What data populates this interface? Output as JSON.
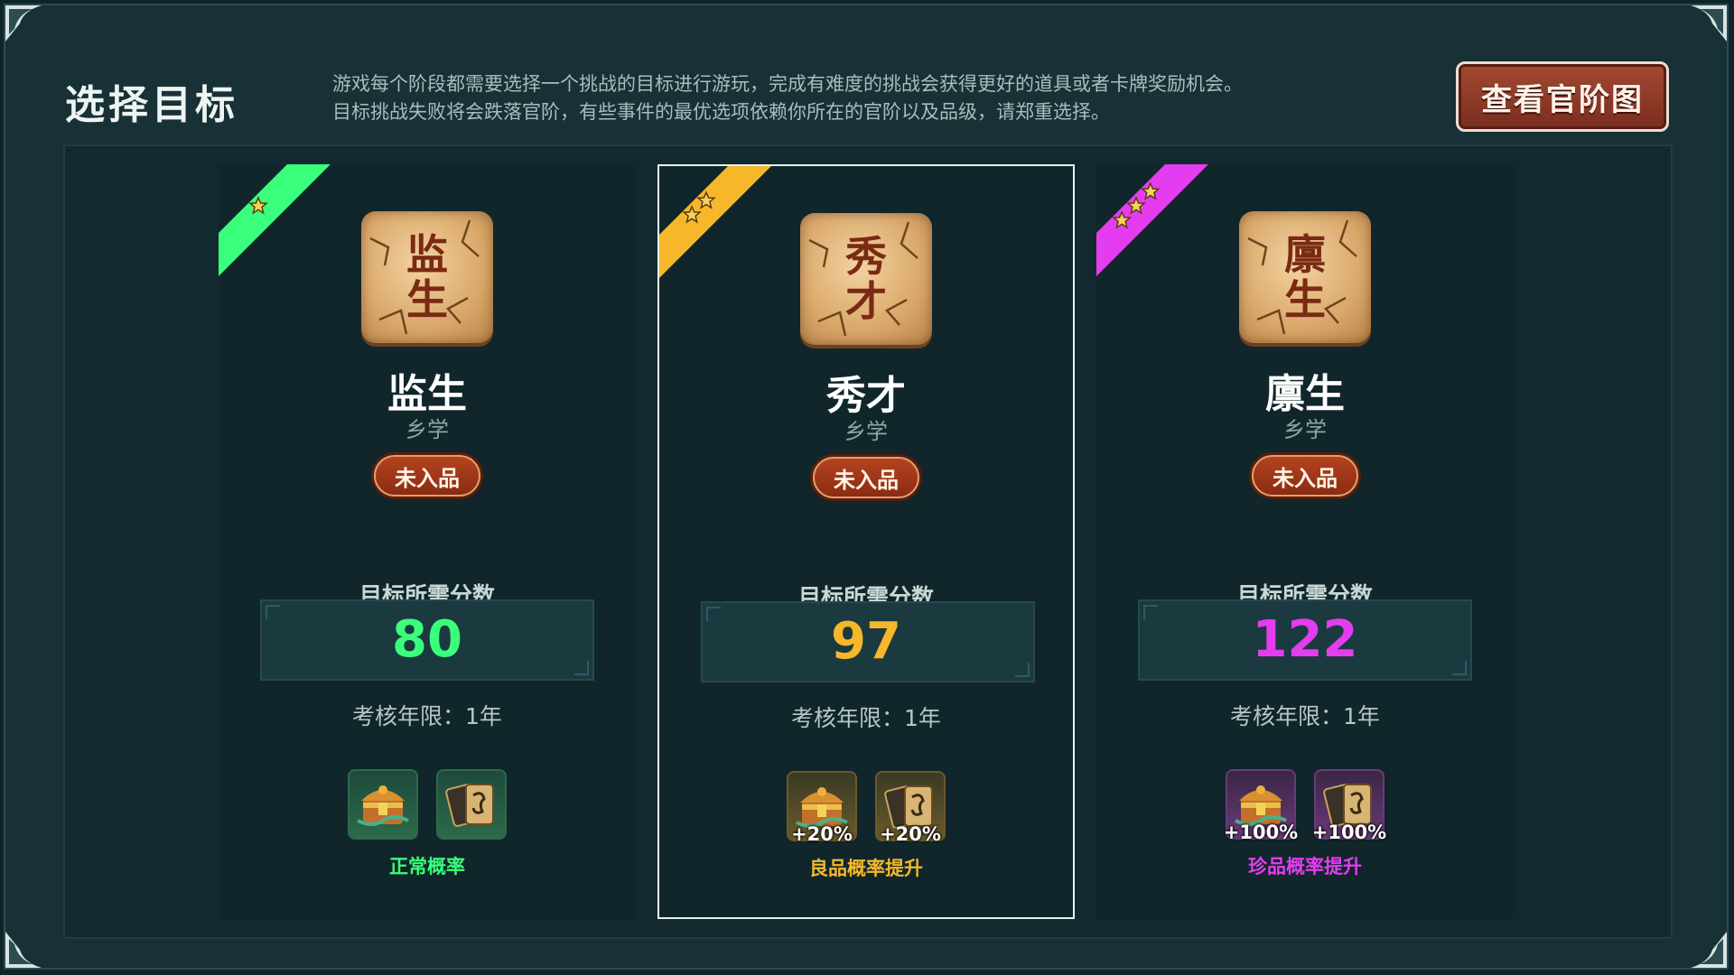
{
  "header": {
    "title": "选择目标",
    "description_line1": "游戏每个阶段都需要选择一个挑战的目标进行游玩，完成有难度的挑战会获得更好的道具或者卡牌奖励机会。",
    "description_line2": "目标挑战失败将会跌落官阶，有些事件的最优选项依赖你所在的官阶以及品级，请郑重选择。",
    "map_button_label": "查看官阶图"
  },
  "cards": [
    {
      "stars": 1,
      "tile_chars": [
        "监",
        "生"
      ],
      "rank_name": "监生",
      "rank_sub": "乡学",
      "badge": "未入品",
      "req_label": "目标所需分数",
      "score": "80",
      "years": "考核年限：1年",
      "reward_bonus": [
        "",
        ""
      ],
      "rate_note": "正常概率",
      "accent": "#39ff7a",
      "selected": false
    },
    {
      "stars": 2,
      "tile_chars": [
        "秀",
        "才"
      ],
      "rank_name": "秀才",
      "rank_sub": "乡学",
      "badge": "未入品",
      "req_label": "目标所需分数",
      "score": "97",
      "years": "考核年限：1年",
      "reward_bonus": [
        "+20%",
        "+20%"
      ],
      "rate_note": "良品概率提升",
      "accent": "#f6b72a",
      "selected": true
    },
    {
      "stars": 3,
      "tile_chars": [
        "廪",
        "生"
      ],
      "rank_name": "廪生",
      "rank_sub": "乡学",
      "badge": "未入品",
      "req_label": "目标所需分数",
      "score": "122",
      "years": "考核年限：1年",
      "reward_bonus": [
        "+100%",
        "+100%"
      ],
      "rate_note": "珍品概率提升",
      "accent": "#e43cf0",
      "selected": false
    }
  ],
  "icons": {
    "reward_1": "treasure-chest-icon",
    "reward_2": "card-deck-icon",
    "ribbon_star": "star-icon"
  }
}
